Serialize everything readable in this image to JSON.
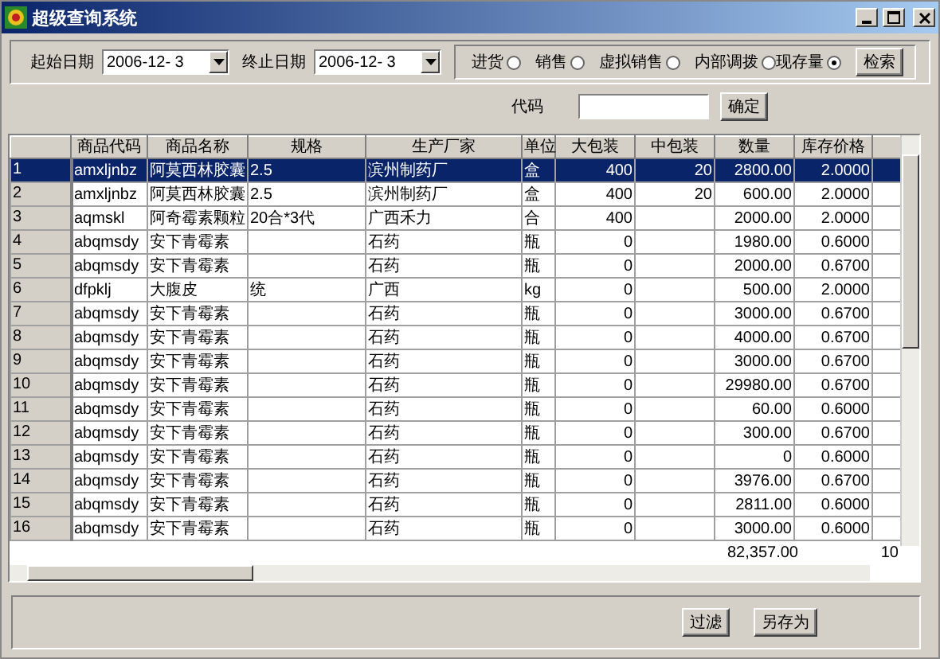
{
  "window": {
    "title": "超级查询系统"
  },
  "filters": {
    "start_label": "起始日期",
    "start_date": "2006-12- 3",
    "end_label": "终止日期",
    "end_date": "2006-12- 3",
    "options": [
      {
        "label": "进货",
        "selected": false
      },
      {
        "label": "销售",
        "selected": false
      },
      {
        "label": "虚拟销售",
        "selected": false
      },
      {
        "label": "内部调拨",
        "selected": false
      },
      {
        "label": "现存量",
        "selected": true
      }
    ],
    "search_button": "检索"
  },
  "code": {
    "label": "代码",
    "confirm_button": "确定"
  },
  "table": {
    "columns": [
      "商品代码",
      "商品名称",
      "规格",
      "生产厂家",
      "单位",
      "大包装",
      "中包装",
      "数量",
      "库存价格"
    ],
    "rows": [
      {
        "number": "1",
        "selected": true,
        "cells": [
          "amxljnbz",
          "阿莫西林胶囊",
          "2.5",
          "滨州制药厂",
          "盒",
          "400",
          "20",
          "2800.00",
          "2.0000"
        ]
      },
      {
        "number": "2",
        "selected": false,
        "cells": [
          "amxljnbz",
          "阿莫西林胶囊",
          "2.5",
          "滨州制药厂",
          "盒",
          "400",
          "20",
          "600.00",
          "2.0000"
        ]
      },
      {
        "number": "3",
        "selected": false,
        "cells": [
          "aqmskl",
          "阿奇霉素颗粒",
          "20合*3代",
          "广西禾力",
          "合",
          "400",
          null,
          "2000.00",
          "2.0000"
        ]
      },
      {
        "number": "4",
        "selected": false,
        "cells": [
          "abqmsdy",
          "安下青霉素",
          null,
          "石药",
          "瓶",
          "0",
          null,
          "1980.00",
          "0.6000"
        ]
      },
      {
        "number": "5",
        "selected": false,
        "cells": [
          "abqmsdy",
          "安下青霉素",
          null,
          "石药",
          "瓶",
          "0",
          null,
          "2000.00",
          "0.6700"
        ]
      },
      {
        "number": "6",
        "selected": false,
        "cells": [
          "dfpklj",
          "大腹皮",
          "统",
          "广西",
          "kg",
          "0",
          null,
          "500.00",
          "2.0000"
        ]
      },
      {
        "number": "7",
        "selected": false,
        "cells": [
          "abqmsdy",
          "安下青霉素",
          null,
          "石药",
          "瓶",
          "0",
          null,
          "3000.00",
          "0.6700"
        ]
      },
      {
        "number": "8",
        "selected": false,
        "cells": [
          "abqmsdy",
          "安下青霉素",
          null,
          "石药",
          "瓶",
          "0",
          null,
          "4000.00",
          "0.6700"
        ]
      },
      {
        "number": "9",
        "selected": false,
        "cells": [
          "abqmsdy",
          "安下青霉素",
          null,
          "石药",
          "瓶",
          "0",
          null,
          "3000.00",
          "0.6700"
        ]
      },
      {
        "number": "10",
        "selected": false,
        "cells": [
          "abqmsdy",
          "安下青霉素",
          null,
          "石药",
          "瓶",
          "0",
          null,
          "29980.00",
          "0.6700"
        ]
      },
      {
        "number": "11",
        "selected": false,
        "cells": [
          "abqmsdy",
          "安下青霉素",
          null,
          "石药",
          "瓶",
          "0",
          null,
          "60.00",
          "0.6000"
        ]
      },
      {
        "number": "12",
        "selected": false,
        "cells": [
          "abqmsdy",
          "安下青霉素",
          null,
          "石药",
          "瓶",
          "0",
          null,
          "300.00",
          "0.6700"
        ]
      },
      {
        "number": "13",
        "selected": false,
        "cells": [
          "abqmsdy",
          "安下青霉素",
          null,
          "石药",
          "瓶",
          "0",
          null,
          "0",
          "0.6000"
        ]
      },
      {
        "number": "14",
        "selected": false,
        "cells": [
          "abqmsdy",
          "安下青霉素",
          null,
          "石药",
          "瓶",
          "0",
          null,
          "3976.00",
          "0.6700"
        ]
      },
      {
        "number": "15",
        "selected": false,
        "cells": [
          "abqmsdy",
          "安下青霉素",
          null,
          "石药",
          "瓶",
          "0",
          null,
          "2811.00",
          "0.6000"
        ]
      },
      {
        "number": "16",
        "selected": false,
        "cells": [
          "abqmsdy",
          "安下青霉素",
          null,
          "石药",
          "瓶",
          "0",
          null,
          "3000.00",
          "0.6000"
        ]
      }
    ],
    "totals": {
      "quantity": "82,357.00",
      "column_11": "10"
    }
  },
  "buttons": [
    "过滤",
    "另存为"
  ]
}
